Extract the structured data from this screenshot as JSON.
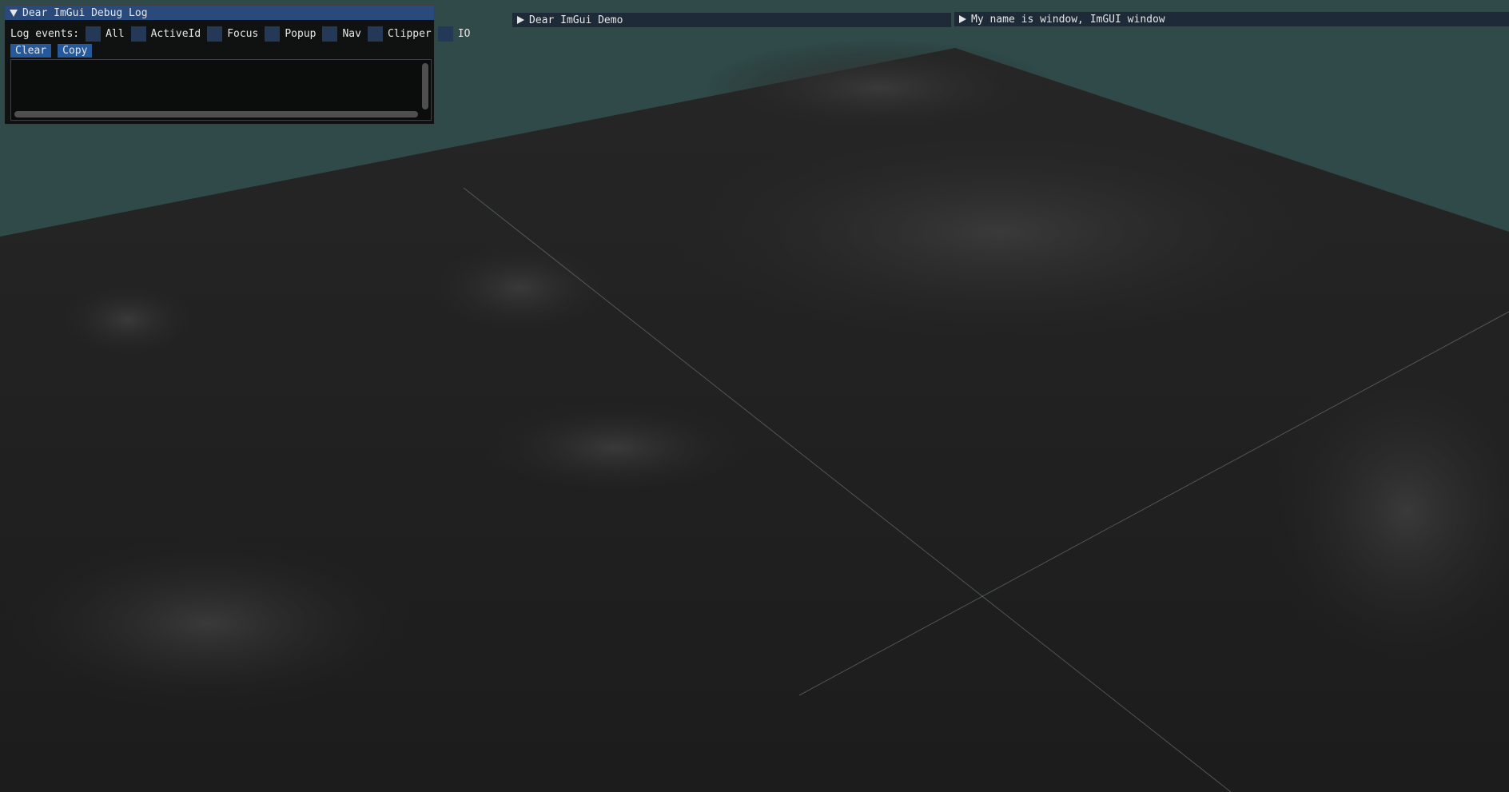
{
  "debug_log": {
    "title": "Dear ImGui Debug Log",
    "log_events_label": "Log events:",
    "checkboxes": [
      "All",
      "ActiveId",
      "Focus",
      "Popup",
      "Nav",
      "Clipper",
      "IO"
    ],
    "clear_label": "Clear",
    "copy_label": "Copy"
  },
  "demo_window": {
    "title": "Dear ImGui Demo"
  },
  "name_window": {
    "title": "My name is window, ImGUI window"
  },
  "colors": {
    "sky": "#2f4a49",
    "terrain": "#1f1f1f",
    "title_active": "#294a7a",
    "title_collapsed": "#1e2a38",
    "button": "#26599b",
    "checkbox": "#243857"
  }
}
